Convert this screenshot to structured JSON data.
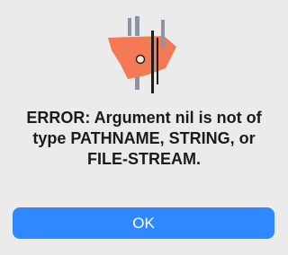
{
  "dialog": {
    "icon": "application-icon",
    "message": "ERROR: Argument nil is not of\ntype PATHNAME, STRING, or\nFILE-STREAM.",
    "ok_label": "OK"
  },
  "colors": {
    "background": "#ebebeb",
    "button": "#2f88ff",
    "button_text": "#ffffff",
    "icon_orange": "#f37a54",
    "icon_gray": "#8a94a4",
    "icon_dark": "#1d1d1d",
    "icon_peach": "#fde3cc"
  }
}
